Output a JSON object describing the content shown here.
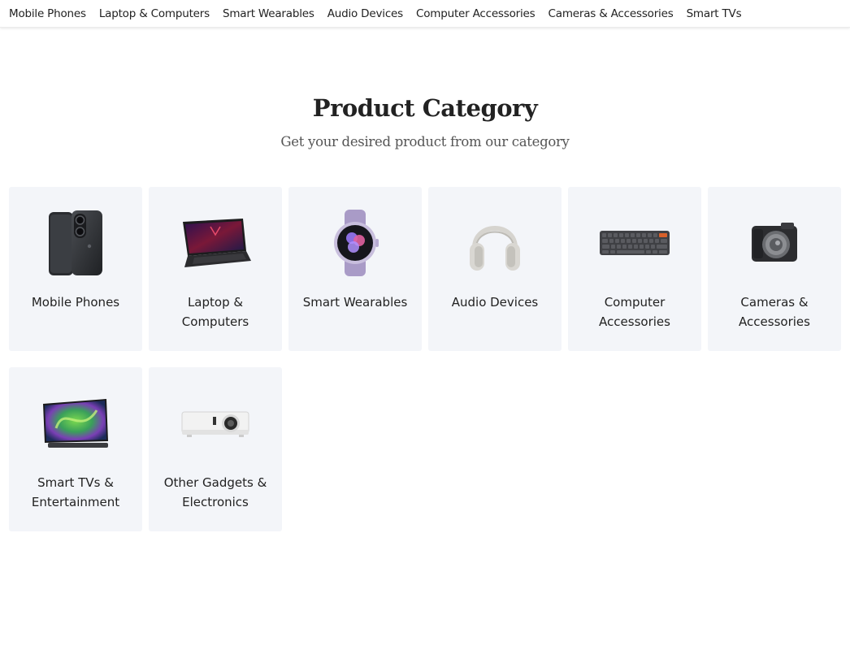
{
  "nav": {
    "links": [
      "Mobile Phones",
      "Laptop & Computers",
      "Smart Wearables",
      "Audio Devices",
      "Computer Accessories",
      "Cameras & Accessories",
      "Smart TVs"
    ]
  },
  "section": {
    "title": "Product Category",
    "subtitle": "Get your desired product from our category"
  },
  "categories": [
    {
      "label": "Mobile Phones",
      "icon": "mobile-phone-icon"
    },
    {
      "label": "Laptop & Computers",
      "icon": "laptop-icon"
    },
    {
      "label": "Smart Wearables",
      "icon": "smartwatch-icon"
    },
    {
      "label": "Audio Devices",
      "icon": "headphones-icon"
    },
    {
      "label": "Computer Accessories",
      "icon": "keyboard-icon"
    },
    {
      "label": "Cameras & Accessories",
      "icon": "camera-icon"
    },
    {
      "label": "Smart TVs & Entertainment",
      "icon": "smart-tv-icon"
    },
    {
      "label": "Other Gadgets & Electronics",
      "icon": "projector-icon"
    }
  ],
  "colors": {
    "card_background": "#f3f5f9",
    "text": "#222222",
    "subtitle": "#555555"
  }
}
